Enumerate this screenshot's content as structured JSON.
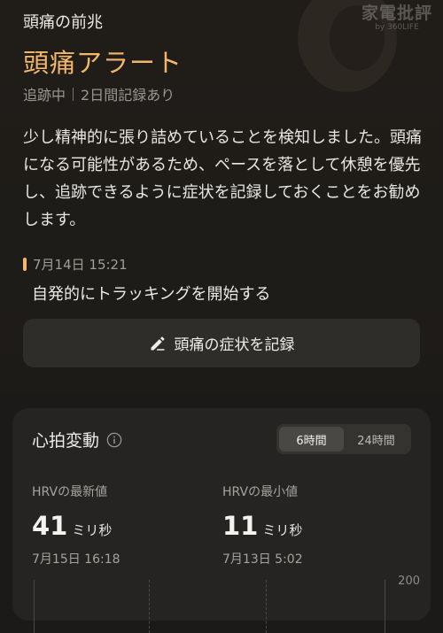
{
  "header": {
    "section_label": "頭痛の前兆",
    "alert_title": "頭痛アラート",
    "status": "追跡中",
    "record_info": "2日間記録あり"
  },
  "watermark": {
    "line1": "家電批評",
    "line2": "by 360LIFE"
  },
  "description": "少し精神的に張り詰めていることを検知しました。頭痛になる可能性があるため、ペースを落として休憩を優先し、追跡できるように症状を記録しておくことをお勧めします。",
  "event": {
    "time": "7月14日 15:21",
    "text": "自発的にトラッキングを開始する"
  },
  "record_button": {
    "label": "頭痛の症状を記録",
    "icon": "pencil-icon"
  },
  "hrv_card": {
    "title": "心拍変動",
    "info_icon": "info-icon",
    "range_tabs": [
      {
        "label": "6時間",
        "active": true
      },
      {
        "label": "24時間",
        "active": false
      }
    ],
    "latest": {
      "label": "HRVの最新値",
      "value": "41",
      "unit": "ミリ秒",
      "date": "7月15日 16:18"
    },
    "minimum": {
      "label": "HRVの最小値",
      "value": "11",
      "unit": "ミリ秒",
      "date": "7月13日 5:02"
    },
    "chart_max_label": "200"
  },
  "colors": {
    "accent": "#f3b66a",
    "background": "#1b1a18",
    "card": "#252422"
  }
}
